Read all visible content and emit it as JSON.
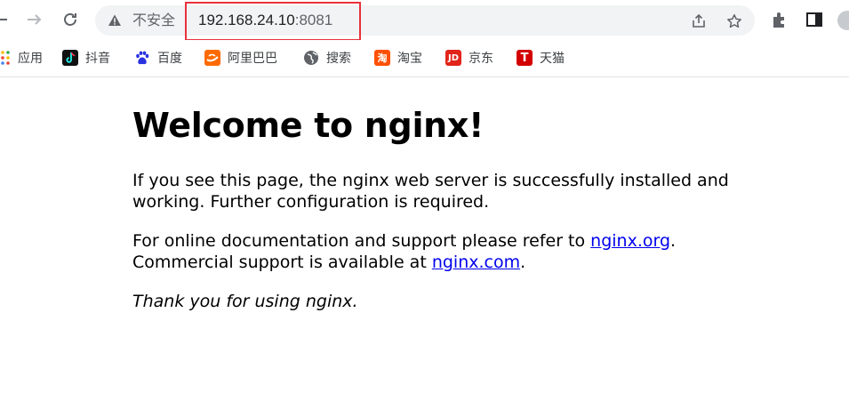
{
  "address_bar": {
    "security_label": "不安全",
    "host": "192.168.24.10",
    "port": ":8081"
  },
  "bookmarks": [
    {
      "label": "应用",
      "icon": "apps-grid-icon"
    },
    {
      "label": "抖音",
      "icon": "douyin-icon"
    },
    {
      "label": "百度",
      "icon": "baidu-paw-icon"
    },
    {
      "label": "阿里巴巴",
      "icon": "alibaba-icon"
    },
    {
      "label": "搜索",
      "icon": "globe-icon"
    },
    {
      "label": "淘宝",
      "icon": "taobao-icon",
      "glyph": "淘"
    },
    {
      "label": "京东",
      "icon": "jd-icon",
      "glyph": "JD"
    },
    {
      "label": "天猫",
      "icon": "tmall-icon",
      "glyph": "T"
    }
  ],
  "page": {
    "heading": "Welcome to nginx!",
    "para1": "If you see this page, the nginx web server is successfully installed and working. Further configuration is required.",
    "para2_prefix": "For online documentation and support please refer to ",
    "link1": "nginx.org",
    "para2_mid": ".",
    "para2_line2": "Commercial support is available at ",
    "link2": "nginx.com",
    "para2_end": ".",
    "para3": "Thank you for using nginx."
  },
  "colors": {
    "highlight_box": "#e8323c",
    "link": "#0000ee",
    "taobao": "#ff5000",
    "jd": "#e1251b",
    "tmall": "#d40000",
    "alibaba": "#ff6a00"
  }
}
